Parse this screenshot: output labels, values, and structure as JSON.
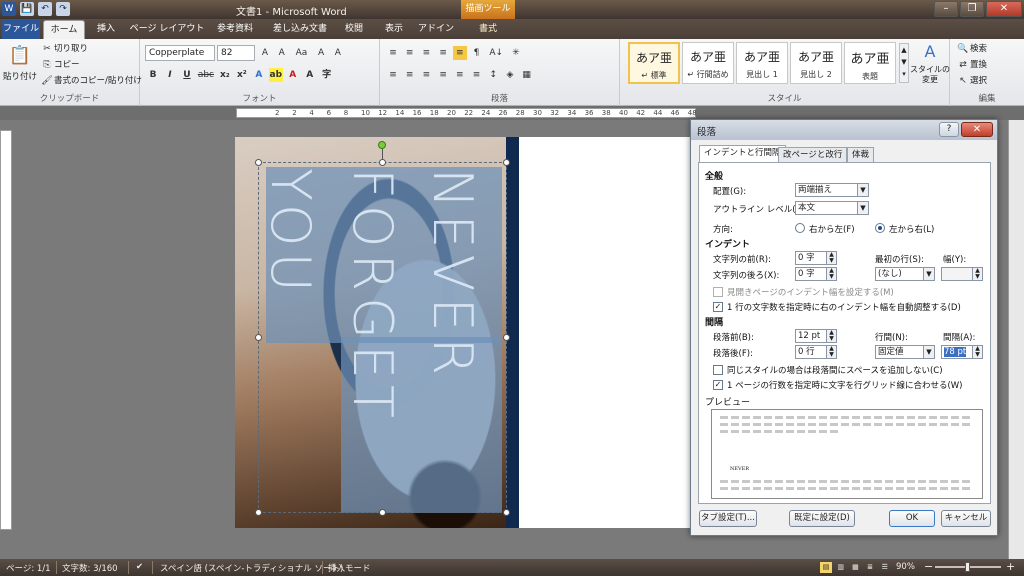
{
  "window": {
    "title": "文書1 - Microsoft Word",
    "tool_label": "描画ツール",
    "quick_access": [
      "W",
      "💾",
      "↶",
      "↷"
    ],
    "min": "–",
    "max": "❐",
    "close": "✕"
  },
  "tabs": [
    "ファイル",
    "ホーム",
    "挿入",
    "ページ レイアウト",
    "参考資料",
    "差し込み文書",
    "校閲",
    "表示",
    "アドイン",
    "書式"
  ],
  "ribbon": {
    "clipboard": {
      "paste": "貼り付け",
      "cut": "切り取り",
      "copy": "コピー",
      "format_painter": "書式のコピー/貼り付け",
      "label": "クリップボード"
    },
    "font": {
      "name": "Copperplate",
      "size": "82",
      "label": "フォント",
      "row1_icons": [
        "A",
        "A",
        "Aa",
        "A",
        "A"
      ],
      "row2_icons": [
        "B",
        "I",
        "U",
        "abc",
        "x₂",
        "x²",
        "A",
        "ab",
        "A",
        "A",
        "字"
      ]
    },
    "paragraph": {
      "label": "段落",
      "row1_icons": [
        "≡",
        "≡",
        "≡",
        "≡",
        "≡",
        "¶",
        "A↓",
        "✳"
      ],
      "row2_icons": [
        "≡",
        "≡",
        "≡",
        "≡",
        "≡",
        "≡",
        "↕",
        "◈",
        "▦"
      ]
    },
    "styles": {
      "label": "スタイル",
      "items": [
        {
          "big": "あア亜",
          "name": "↵ 標準"
        },
        {
          "big": "あア亜",
          "name": "↵ 行間詰め"
        },
        {
          "big": "あア亜",
          "name": "見出し 1"
        },
        {
          "big": "あア亜",
          "name": "見出し 2"
        },
        {
          "big": "あア亜",
          "name": "表題"
        }
      ],
      "change": "スタイルの\n変更"
    },
    "editing": {
      "label": "編集",
      "find": "検索",
      "replace": "置換",
      "select": "選択"
    }
  },
  "ruler": {
    "ticks": [
      "2",
      "2",
      "4",
      "6",
      "8",
      "10",
      "12",
      "14",
      "16",
      "18",
      "20",
      "22",
      "24",
      "26",
      "28",
      "30",
      "32",
      "34",
      "36",
      "38",
      "40",
      "42",
      "44",
      "46",
      "48"
    ]
  },
  "document": {
    "words": [
      "NEVER",
      "FORGET",
      "YOU"
    ]
  },
  "dialog": {
    "title": "段落",
    "help": "?",
    "close": "✕",
    "tabs": [
      "インデントと行間隔",
      "改ページと改行",
      "体裁"
    ],
    "general": {
      "section": "全般",
      "alignment_label": "配置(G):",
      "alignment_value": "両端揃え",
      "outline_label": "アウトライン レベル(O):",
      "outline_value": "本文",
      "direction_label": "方向:",
      "rtl": "右から左(F)",
      "ltr": "左から右(L)"
    },
    "indent": {
      "section": "インデント",
      "before_label": "文字列の前(R):",
      "before_value": "0 字",
      "after_label": "文字列の後ろ(X):",
      "after_value": "0 字",
      "first_label": "最初の行(S):",
      "first_value": "(なし)",
      "width_label": "幅(Y):",
      "width_value": "",
      "mirror": "見開きページのインデント幅を設定する(M)",
      "auto_adjust": "1 行の文字数を指定時に右のインデント幅を自動調整する(D)"
    },
    "spacing": {
      "section": "間隔",
      "before_label": "段落前(B):",
      "before_value": "12 pt",
      "after_label": "段落後(F):",
      "after_value": "0 行",
      "line_label": "行間(N):",
      "line_value": "固定値",
      "at_label": "間隔(A):",
      "at_value": "78 pt",
      "no_space": "同じスタイルの場合は段落間にスペースを追加しない(C)",
      "snap_grid": "1 ページの行数を指定時に文字を行グリッド線に合わせる(W)"
    },
    "preview": {
      "section": "プレビュー",
      "sample": "NEVER"
    },
    "buttons": {
      "tabs": "タブ設定(T)...",
      "default": "既定に設定(D)",
      "ok": "OK",
      "cancel": "キャンセル"
    }
  },
  "status": {
    "page": "ページ: 1/1",
    "words": "文字数: 3/160",
    "language": "スペイン語 (スペイン-トラディショナル ソート)",
    "mode": "挿入モード",
    "zoom": "90%",
    "zoom_minus": "−",
    "zoom_plus": "+"
  },
  "colors": {
    "accent": "#2b579a",
    "navy": "#0f2a4e",
    "overlay": "#6e91b9"
  }
}
